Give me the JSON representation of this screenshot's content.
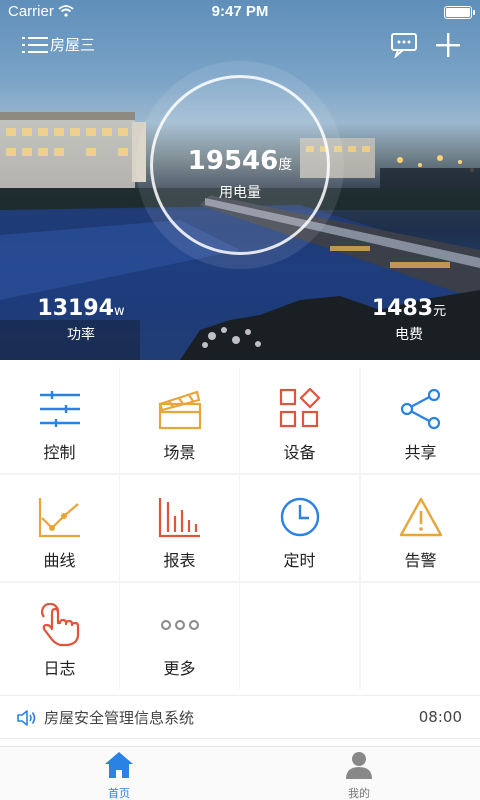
{
  "status_bar": {
    "carrier": "Carrier",
    "time": "9:47 PM"
  },
  "nav": {
    "house_name": "房屋三",
    "icons": [
      "menu-icon",
      "chat-icon",
      "plus-icon"
    ]
  },
  "energy": {
    "value": "19546",
    "unit": "度",
    "label": "用电量"
  },
  "power": {
    "value": "13194",
    "unit": "w",
    "label": "功率"
  },
  "fee": {
    "value": "1483",
    "unit": "元",
    "label": "电费"
  },
  "grid": {
    "items": [
      {
        "label": "控制",
        "icon": "sliders-icon",
        "color": "#2a82e4"
      },
      {
        "label": "场景",
        "icon": "clapperboard-icon",
        "color": "#e8a63a"
      },
      {
        "label": "设备",
        "icon": "devices-icon",
        "color": "#e0543c"
      },
      {
        "label": "共享",
        "icon": "share-icon",
        "color": "#2a82e4"
      },
      {
        "label": "曲线",
        "icon": "line-chart-icon",
        "color": "#e8a63a"
      },
      {
        "label": "报表",
        "icon": "bar-chart-icon",
        "color": "#e0543c"
      },
      {
        "label": "定时",
        "icon": "clock-icon",
        "color": "#2a82e4"
      },
      {
        "label": "告警",
        "icon": "warning-icon",
        "color": "#e8a63a"
      },
      {
        "label": "日志",
        "icon": "hand-pointer-icon",
        "color": "#e0543c"
      },
      {
        "label": "更多",
        "icon": "more-icon",
        "color": "#888888"
      }
    ]
  },
  "notice": {
    "text": "房屋安全管理信息系统",
    "time": "08:00"
  },
  "tabs": [
    {
      "label": "首页",
      "icon": "home-icon",
      "active": true,
      "color": "#2a82e4"
    },
    {
      "label": "我的",
      "icon": "user-icon",
      "active": false,
      "color": "#777777"
    }
  ]
}
